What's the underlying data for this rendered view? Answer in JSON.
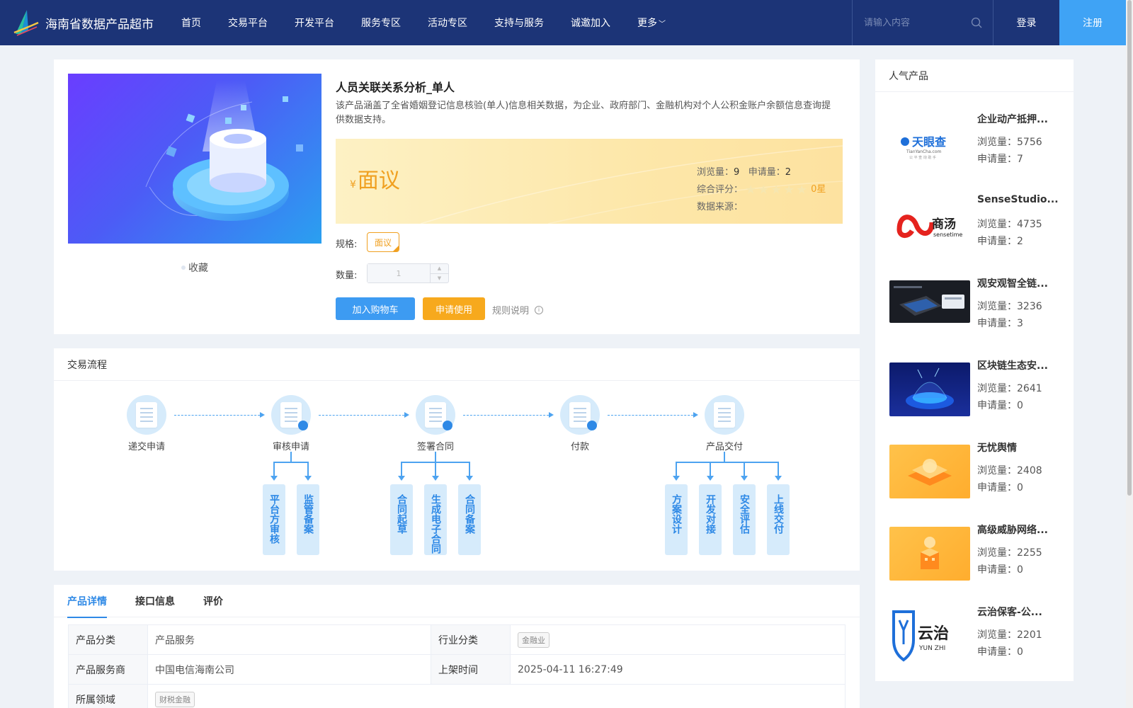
{
  "header": {
    "site_name": "海南省数据产品超市",
    "nav": [
      "首页",
      "交易平台",
      "开发平台",
      "服务专区",
      "活动专区",
      "支持与服务",
      "诚邀加入",
      "更多"
    ],
    "search_placeholder": "请输入内容",
    "login": "登录",
    "register": "注册"
  },
  "product": {
    "title": "人员关联关系分析_单人",
    "description": "该产品涵盖了全省婚姻登记信息核验(单人)信息相关数据，为企业、政府部门、金融机构对个人公积金账户余额信息查询提供数据支持。",
    "currency": "¥",
    "price": "面议",
    "views_label": "浏览量：",
    "views": "9",
    "applies_label": "申请量：",
    "applies": "2",
    "rating_label": "综合评分：",
    "rating": 0,
    "rating_text": "0星",
    "source_label": "数据来源：",
    "source": "",
    "favorite": "收藏",
    "spec_label": "规格:",
    "spec_value": "面议",
    "qty_label": "数量:",
    "qty_value": "1",
    "add_cart": "加入购物车",
    "apply": "申请使用",
    "rules": "规则说明"
  },
  "flow": {
    "title": "交易流程",
    "steps": [
      "递交申请",
      "审核申请",
      "签署合同",
      "付款",
      "产品交付"
    ],
    "sub_review": [
      "平台方审核",
      "监管备案"
    ],
    "sub_contract": [
      "合同起草",
      "生成电子合同",
      "合同备案"
    ],
    "sub_delivery": [
      "方案设计",
      "开发对接",
      "安全评估",
      "上线交付"
    ]
  },
  "details": {
    "tabs": [
      "产品详情",
      "接口信息",
      "评价"
    ],
    "rows": [
      {
        "k1": "产品分类",
        "v1": "产品服务",
        "k2": "行业分类",
        "v2": "金融业"
      },
      {
        "k1": "产品服务商",
        "v1": "中国电信海南公司",
        "k2": "上架时间",
        "v2": "2025-04-11 16:27:49"
      },
      {
        "k1": "所属领域",
        "v1": "财税金融"
      }
    ]
  },
  "popular": {
    "title": "人气产品",
    "views_label": "浏览量：",
    "applies_label": "申请量：",
    "items": [
      {
        "name": "企业动产抵押...",
        "views": "5756",
        "applies": "7",
        "logo_text": "天眼查",
        "logo_sub": "TianYanCha.com",
        "logo_sub2": "公 平 查 询 助 手"
      },
      {
        "name": "SenseStudio...",
        "views": "4735",
        "applies": "2",
        "logo_text": "商汤",
        "logo_sub": "sensetime"
      },
      {
        "name": "观安观智全链...",
        "views": "3236",
        "applies": "3"
      },
      {
        "name": "区块链生态安...",
        "views": "2641",
        "applies": "0"
      },
      {
        "name": "无忧舆情",
        "views": "2408",
        "applies": "0"
      },
      {
        "name": "高级威胁网络...",
        "views": "2255",
        "applies": "0"
      },
      {
        "name": "云治保客-公...",
        "views": "2201",
        "applies": "0",
        "logo_text": "云治",
        "logo_sub": "YUN ZHI"
      }
    ]
  },
  "colors": {
    "header_bg": "#1c3477",
    "accent": "#3fa3f5",
    "price": "#f0a020"
  }
}
